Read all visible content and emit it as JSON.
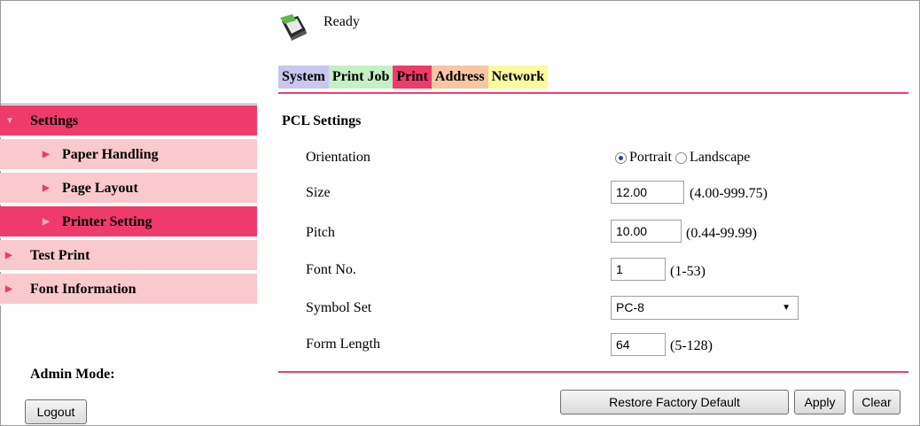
{
  "status": {
    "text": "Ready",
    "icon": "printer-status-icon"
  },
  "tabs": [
    {
      "label": "System"
    },
    {
      "label": "Print Job"
    },
    {
      "label": "Print"
    },
    {
      "label": "Address"
    },
    {
      "label": "Network"
    }
  ],
  "sidebar": {
    "items": [
      {
        "label": "Settings"
      },
      {
        "label": "Paper Handling"
      },
      {
        "label": "Page Layout"
      },
      {
        "label": "Printer Setting"
      },
      {
        "label": "Test Print"
      },
      {
        "label": "Font Information"
      }
    ],
    "admin_label": "Admin Mode:",
    "logout_label": "Logout"
  },
  "main": {
    "title": "PCL Settings",
    "orientation": {
      "label": "Orientation",
      "options": [
        "Portrait",
        "Landscape"
      ],
      "selected": "Portrait"
    },
    "size": {
      "label": "Size",
      "value": "12.00",
      "range": "(4.00-999.75)"
    },
    "pitch": {
      "label": "Pitch",
      "value": "10.00",
      "range": "(0.44-99.99)"
    },
    "font_no": {
      "label": "Font No.",
      "value": "1",
      "range": "(1-53)"
    },
    "symbol_set": {
      "label": "Symbol Set",
      "value": "PC-8"
    },
    "form_length": {
      "label": "Form Length",
      "value": "64",
      "range": "(5-128)"
    }
  },
  "buttons": {
    "restore": "Restore Factory Default",
    "apply": "Apply",
    "clear": "Clear"
  },
  "colors": {
    "accent": "#ee3b6a",
    "sidebar_inactive": "#f9c9cd"
  }
}
